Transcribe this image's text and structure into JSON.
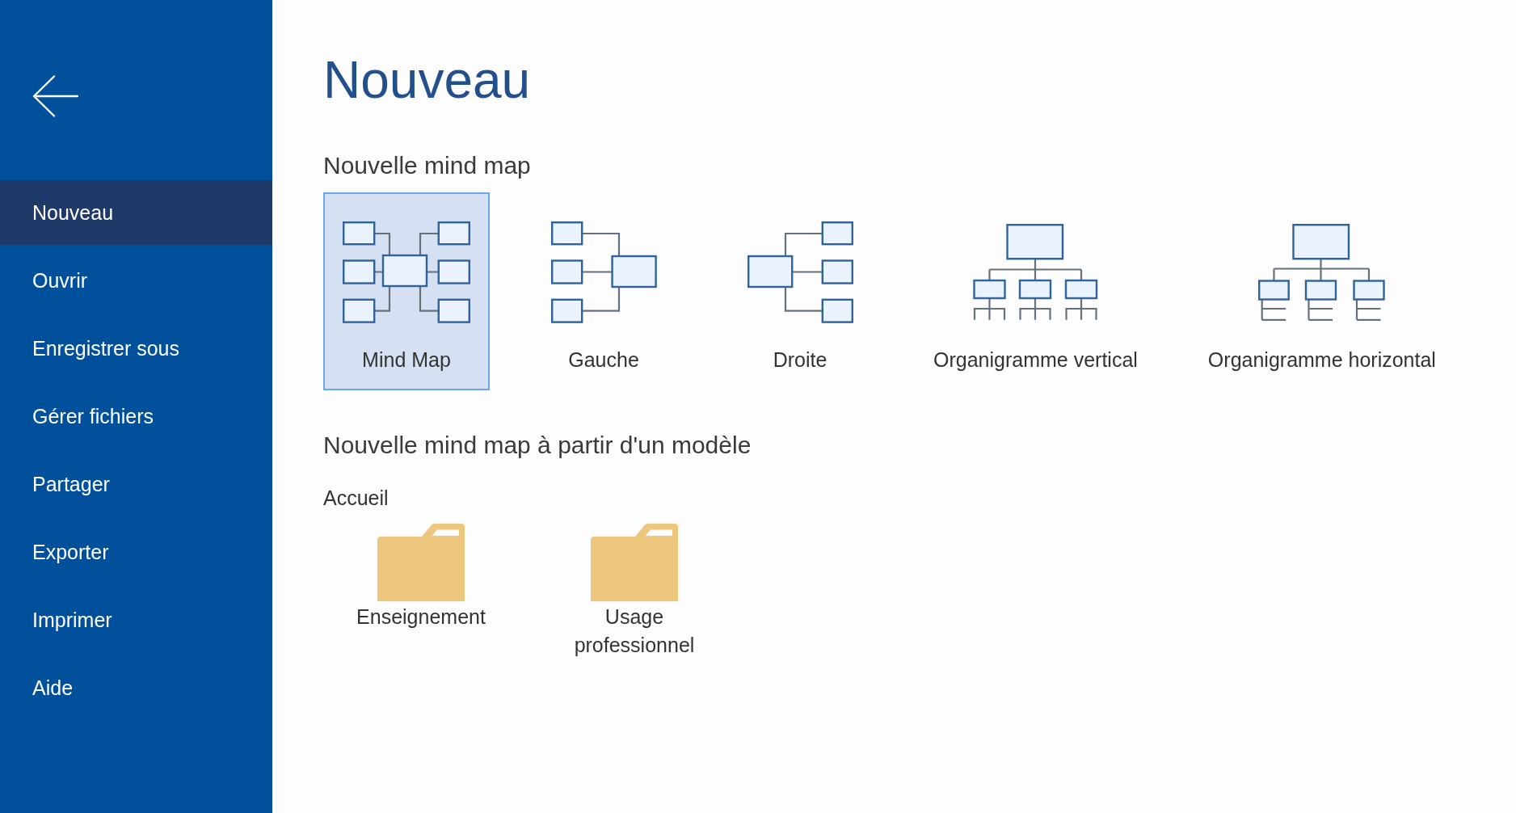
{
  "sidebar": {
    "items": [
      {
        "label": "Nouveau",
        "selected": true
      },
      {
        "label": "Ouvrir",
        "selected": false
      },
      {
        "label": "Enregistrer sous",
        "selected": false
      },
      {
        "label": "Gérer fichiers",
        "selected": false
      },
      {
        "label": "Partager",
        "selected": false
      },
      {
        "label": "Exporter",
        "selected": false
      },
      {
        "label": "Imprimer",
        "selected": false
      },
      {
        "label": "Aide",
        "selected": false
      }
    ]
  },
  "page": {
    "title": "Nouveau"
  },
  "new_section": {
    "heading": "Nouvelle mind map",
    "templates": [
      {
        "kind": "mindmap",
        "label": "Mind Map",
        "selected": true
      },
      {
        "kind": "left",
        "label": "Gauche",
        "selected": false
      },
      {
        "kind": "right",
        "label": "Droite",
        "selected": false
      },
      {
        "kind": "org_vertical",
        "label": "Organigramme vertical",
        "selected": false
      },
      {
        "kind": "org_horizontal",
        "label": "Organigramme horizontal",
        "selected": false
      }
    ]
  },
  "template_section": {
    "heading": "Nouvelle mind map à partir d'un modèle",
    "breadcrumb": "Accueil",
    "folders": [
      {
        "label": "Enseignement"
      },
      {
        "label": "Usage professionnel"
      }
    ]
  }
}
